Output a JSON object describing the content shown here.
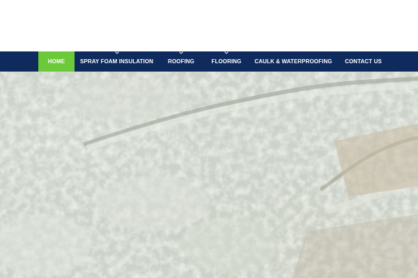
{
  "nav": {
    "items": [
      {
        "label": "HOME",
        "active": true,
        "has_dropdown": false
      },
      {
        "label": "SPRAY FOAM INSULATION",
        "active": false,
        "has_dropdown": true
      },
      {
        "label": "ROOFING",
        "active": false,
        "has_dropdown": true
      },
      {
        "label": "FLOORING",
        "active": false,
        "has_dropdown": true
      },
      {
        "label": "CAULK & WATERPROOFING",
        "active": false,
        "has_dropdown": false
      },
      {
        "label": "CONTACT US",
        "active": false,
        "has_dropdown": false
      }
    ],
    "colors": {
      "bar": "#0f2b5e",
      "active": "#6cc93a",
      "text": "#ffffff"
    }
  },
  "hero": {
    "image_subject": "spray-foam-insulation-texture"
  }
}
